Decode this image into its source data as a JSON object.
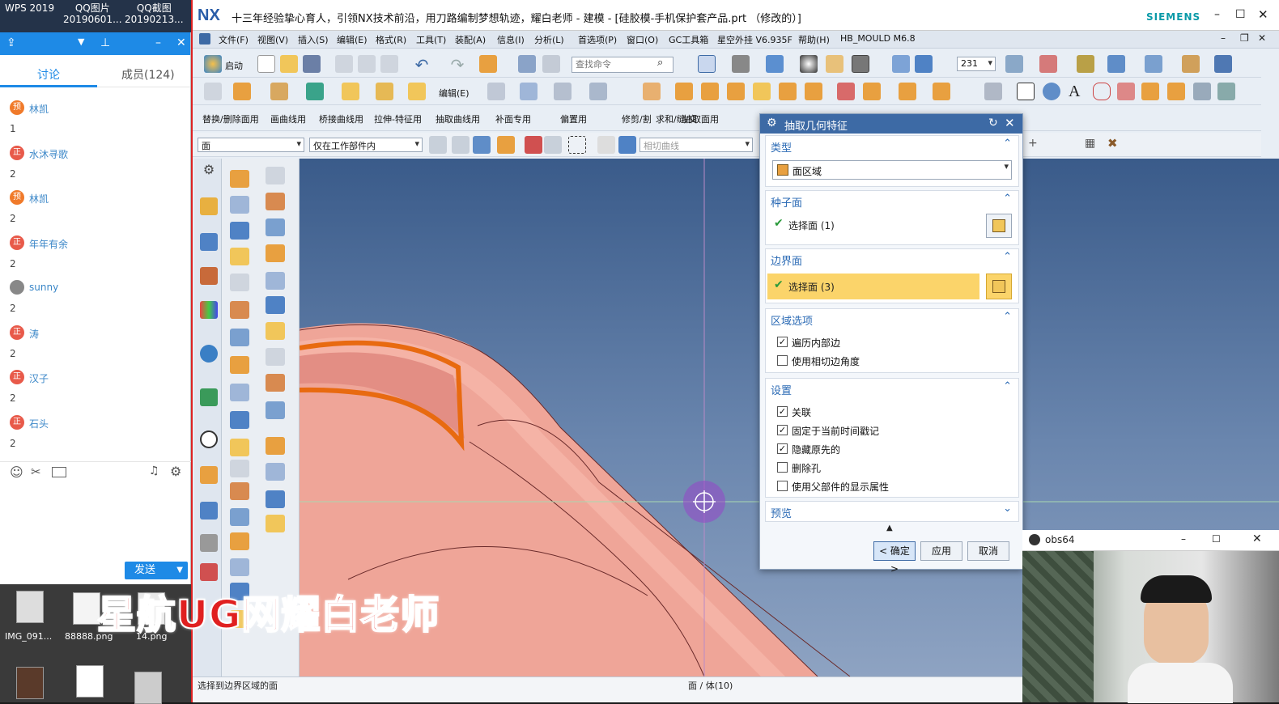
{
  "desktop": {
    "icons_top": [
      {
        "name": "WPS 2019",
        "sub": ""
      },
      {
        "name": "QQ图片",
        "sub": "20190601..."
      },
      {
        "name": "QQ截图",
        "sub": "20190213..."
      }
    ],
    "icons_bottom": [
      "IMG_091...",
      "88888.png",
      "14.png"
    ]
  },
  "qq": {
    "tabs": {
      "discussion": "讨论",
      "members": "成员(124)"
    },
    "messages": [
      {
        "badge": "预",
        "name": "林凯",
        "body": "1",
        "color": "#f07a2a"
      },
      {
        "badge": "正",
        "name": "水沐寻歌",
        "body": "2",
        "color": "#e85a4a"
      },
      {
        "badge": "预",
        "name": "林凯",
        "body": "2",
        "color": "#f07a2a"
      },
      {
        "badge": "正",
        "name": "年年有余",
        "body": "2",
        "color": "#e85a4a"
      },
      {
        "badge": "",
        "name": "sunny",
        "body": "2",
        "color": "#888"
      },
      {
        "badge": "正",
        "name": "涛",
        "body": "2",
        "color": "#e85a4a"
      },
      {
        "badge": "正",
        "name": "汉子",
        "body": "2",
        "color": "#e85a4a"
      },
      {
        "badge": "正",
        "name": "石头",
        "body": "2",
        "color": "#e85a4a"
      }
    ],
    "send_label": "发送"
  },
  "nx": {
    "logo": "NX",
    "title": "十三年经验挚心育人，引领NX技术前沿，用刀路编制梦想轨迹，耀白老师 - 建模 - [硅胶模-手机保护套产品.prt （修改的）]",
    "brand": "SIEMENS",
    "menu": [
      "文件(F)",
      "视图(V)",
      "插入(S)",
      "编辑(E)",
      "格式(R)",
      "工具(T)",
      "装配(A)",
      "信息(I)",
      "分析(L)",
      "首选项(P)",
      "窗口(O)",
      "GC工具箱",
      "星空外挂 V6.935F",
      "帮助(H)",
      "HB_MOULD M6.8"
    ],
    "toolbar": {
      "start_label": "启动",
      "search_placeholder": "查找命令",
      "zoom_value": "231",
      "edit_label": "编辑(E)"
    },
    "toolbar_row3": [
      "替换/删除面用",
      "画曲线用",
      "桥接曲线用",
      "拉伸-特征用",
      "抽取曲线用",
      "补面专用",
      "偏置用",
      "修剪/割",
      "求和/缝/交",
      "抽取面用"
    ],
    "selection": {
      "filter": "面",
      "scope": "仅在工作部件内",
      "curve_rule": "相切曲线"
    },
    "status_left": "选择到边界区域的面",
    "status_mid": "面 / 体(10)"
  },
  "dialog": {
    "title": "抽取几何特征",
    "type_section": "类型",
    "type_value": "面区域",
    "seed_section": "种子面",
    "seed_select": "选择面 (1)",
    "boundary_section": "边界面",
    "boundary_select": "选择面 (3)",
    "region_section": "区域选项",
    "region_options": [
      {
        "label": "遍历内部边",
        "checked": true
      },
      {
        "label": "使用相切边角度",
        "checked": false
      }
    ],
    "settings_section": "设置",
    "settings_options": [
      {
        "label": "关联",
        "checked": true
      },
      {
        "label": "固定于当前时间戳记",
        "checked": true
      },
      {
        "label": "隐藏原先的",
        "checked": true
      },
      {
        "label": "删除孔",
        "checked": false
      },
      {
        "label": "使用父部件的显示属性",
        "checked": false
      }
    ],
    "preview_section": "预览",
    "ok": "< 确定 >",
    "apply": "应用",
    "cancel": "取消"
  },
  "obs": {
    "title": "obs64"
  },
  "overlay": "星航UG网耀白老师",
  "colors": {
    "accent": "#3d6aa5",
    "highlight": "#fbd46a",
    "part": "#f0a096",
    "qq_blue": "#1e8ae6"
  }
}
